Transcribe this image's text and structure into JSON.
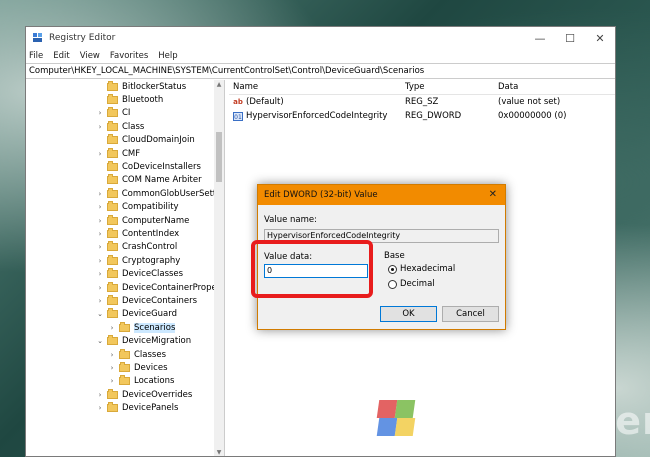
{
  "window": {
    "title": "Registry Editor",
    "controls": {
      "minimize": "—",
      "maximize": "☐",
      "close": "✕"
    }
  },
  "menu": [
    "File",
    "Edit",
    "View",
    "Favorites",
    "Help"
  ],
  "address": "Computer\\HKEY_LOCAL_MACHINE\\SYSTEM\\CurrentControlSet\\Control\\DeviceGuard\\Scenarios",
  "tree": [
    {
      "label": "BitlockerStatus",
      "chevron": "",
      "indent": 0
    },
    {
      "label": "Bluetooth",
      "chevron": "",
      "indent": 0
    },
    {
      "label": "CI",
      "chevron": "›",
      "indent": 0
    },
    {
      "label": "Class",
      "chevron": "›",
      "indent": 0
    },
    {
      "label": "CloudDomainJoin",
      "chevron": "",
      "indent": 0
    },
    {
      "label": "CMF",
      "chevron": "›",
      "indent": 0
    },
    {
      "label": "CoDeviceInstallers",
      "chevron": "",
      "indent": 0
    },
    {
      "label": "COM Name Arbiter",
      "chevron": "",
      "indent": 0
    },
    {
      "label": "CommonGlobUserSettin",
      "chevron": "›",
      "indent": 0
    },
    {
      "label": "Compatibility",
      "chevron": "›",
      "indent": 0
    },
    {
      "label": "ComputerName",
      "chevron": "›",
      "indent": 0
    },
    {
      "label": "ContentIndex",
      "chevron": "›",
      "indent": 0
    },
    {
      "label": "CrashControl",
      "chevron": "›",
      "indent": 0
    },
    {
      "label": "Cryptography",
      "chevron": "›",
      "indent": 0
    },
    {
      "label": "DeviceClasses",
      "chevron": "›",
      "indent": 0
    },
    {
      "label": "DeviceContainerPropert",
      "chevron": "›",
      "indent": 0
    },
    {
      "label": "DeviceContainers",
      "chevron": "›",
      "indent": 0
    },
    {
      "label": "DeviceGuard",
      "chevron": "⌄",
      "indent": 0
    },
    {
      "label": "Scenarios",
      "chevron": "›",
      "indent": 1,
      "selected": true
    },
    {
      "label": "DeviceMigration",
      "chevron": "⌄",
      "indent": 0
    },
    {
      "label": "Classes",
      "chevron": "›",
      "indent": 1
    },
    {
      "label": "Devices",
      "chevron": "›",
      "indent": 1
    },
    {
      "label": "Locations",
      "chevron": "›",
      "indent": 1
    },
    {
      "label": "DeviceOverrides",
      "chevron": "›",
      "indent": 0
    },
    {
      "label": "DevicePanels",
      "chevron": "›",
      "indent": 0
    }
  ],
  "values": {
    "headers": {
      "name": "Name",
      "type": "Type",
      "data": "Data"
    },
    "rows": [
      {
        "name": "(Default)",
        "type": "REG_SZ",
        "data": "(value not set)",
        "icon": "string-value-icon"
      },
      {
        "name": "HypervisorEnforcedCodeIntegrity",
        "type": "REG_DWORD",
        "data": "0x00000000 (0)",
        "icon": "dword-value-icon"
      }
    ]
  },
  "dialog": {
    "title": "Edit DWORD (32-bit) Value",
    "close": "✕",
    "value_name_label": "Value name:",
    "value_name": "HypervisorEnforcedCodeIntegrity",
    "value_data_label": "Value data:",
    "value_data": "0",
    "base_label": "Base",
    "radio_hex": "Hexadecimal",
    "radio_dec": "Decimal",
    "selected_base": "Hexadecimal",
    "ok": "OK",
    "cancel": "Cancel"
  },
  "colors": {
    "dialog_title_bar": "#f28b00",
    "highlight_box": "#e81c1c",
    "tree_selection": "#cce8ff"
  },
  "watermark": "WinBuzzer"
}
